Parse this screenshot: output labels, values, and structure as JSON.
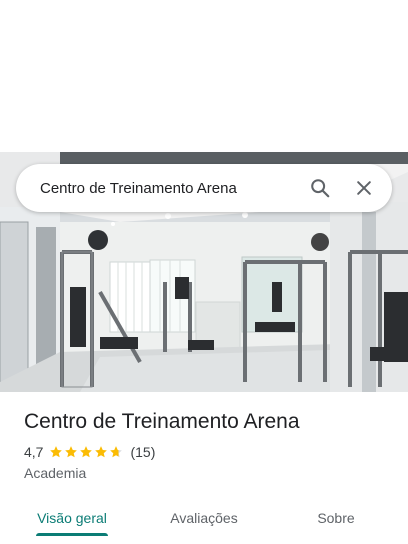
{
  "search": {
    "query": "Centro de Treinamento Arena"
  },
  "place": {
    "name": "Centro de Treinamento Arena",
    "rating": "4,7",
    "stars": 4.7,
    "review_count": "(15)",
    "category": "Academia"
  },
  "tabs": [
    {
      "label": "Visão geral",
      "active": true
    },
    {
      "label": "Avaliações",
      "active": false
    },
    {
      "label": "Sobre",
      "active": false
    }
  ],
  "colors": {
    "accent": "#0b7c75",
    "star": "#fbbc04",
    "text": "#202124",
    "subtle": "#5f6368"
  },
  "icons": {
    "search": "search-icon",
    "close": "close-icon"
  }
}
